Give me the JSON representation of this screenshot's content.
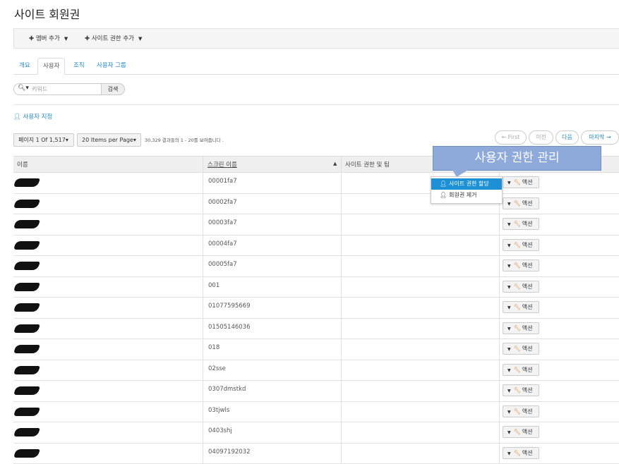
{
  "page_title": "사이트 회원권",
  "toolbar": {
    "add_member": "멤버 추가",
    "add_permission": "사이트 권한 추가"
  },
  "tabs": [
    "개요",
    "사용자",
    "조직",
    "사용자 그룹"
  ],
  "search": {
    "placeholder": "키워드",
    "button": "검색"
  },
  "assign_link": "사용자 지정",
  "pagination": {
    "page": "페이지 1 Of 1,517",
    "per_page": "20 Items per Page",
    "info": "30,329 결과들의 1 - 20를 보여줍니다 .",
    "first": "← First",
    "prev": "이전",
    "next": "다음",
    "last": "마지막 →"
  },
  "table": {
    "headers": [
      "이름",
      "스크린 이름",
      "사이트 권한 및 팀"
    ],
    "screen_names": [
      "00001fa7",
      "00002fa7",
      "00003fa7",
      "00004fa7",
      "00005fa7",
      "001",
      "01077595669",
      "01505146036",
      "018",
      "02sse",
      "0307dmstkd",
      "03tjwls",
      "0403shj",
      "04097192032"
    ],
    "action_label": "액션"
  },
  "callout": "사용자 권한 관리",
  "menu": {
    "assign": "사이트 권한 할당",
    "remove": "회원권 제거"
  }
}
